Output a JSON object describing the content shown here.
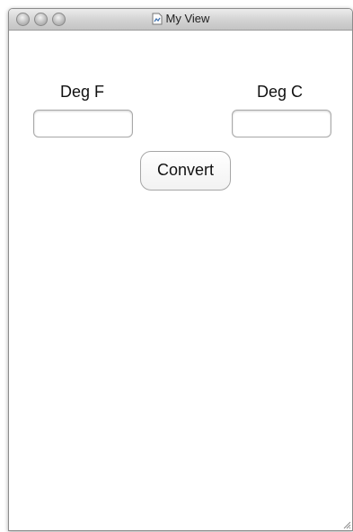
{
  "window": {
    "title": "My View"
  },
  "form": {
    "fahrenheit": {
      "label": "Deg F",
      "value": ""
    },
    "celsius": {
      "label": "Deg C",
      "value": ""
    },
    "convert_label": "Convert"
  },
  "icons": {
    "close": "close-button-icon",
    "minimize": "minimize-button-icon",
    "zoom": "zoom-button-icon",
    "title": "document-icon",
    "resize": "resize-grip-icon"
  }
}
